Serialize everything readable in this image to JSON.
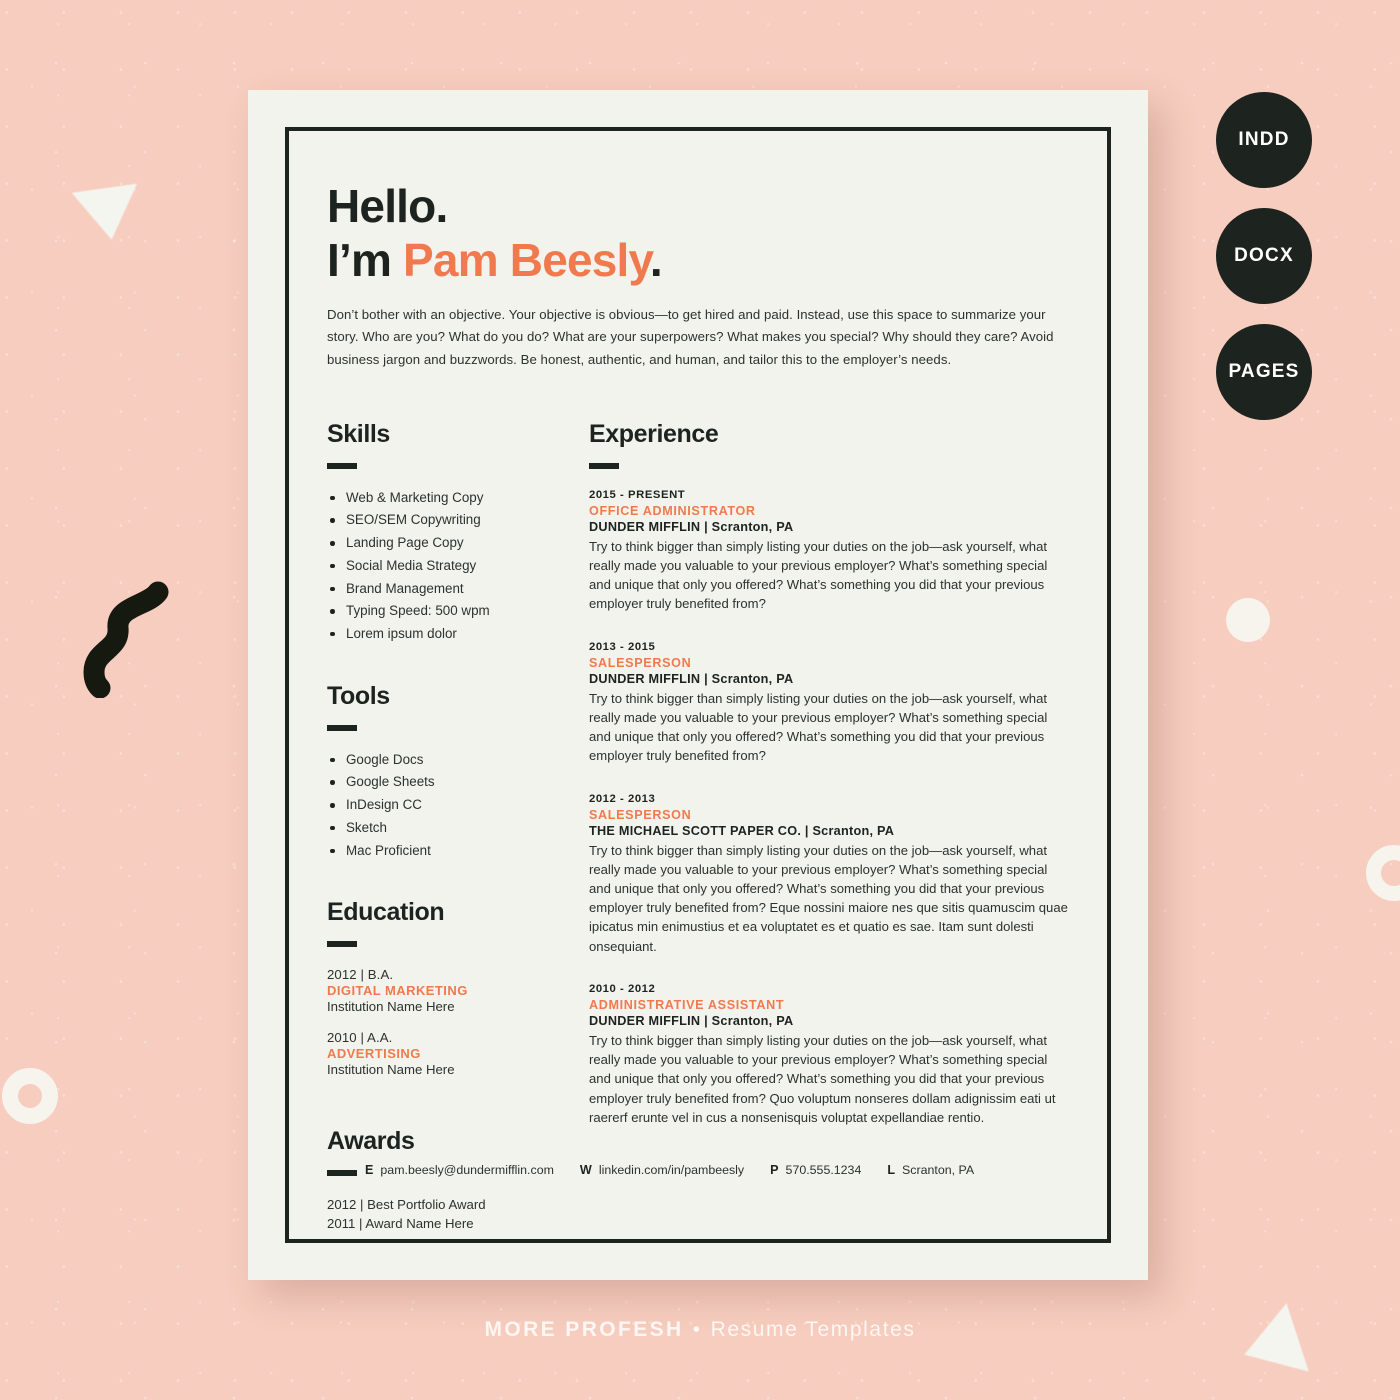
{
  "canvas": {
    "background_color": "#f6cdbe",
    "accent_color": "#f07a4e",
    "ink_color": "#1d231f",
    "paper_color": "#f3f3ee"
  },
  "badges": [
    {
      "label": "INDD"
    },
    {
      "label": "DOCX"
    },
    {
      "label": "PAGES"
    }
  ],
  "resume": {
    "greeting": "Hello.",
    "name_prefix": "I’m ",
    "name": "Pam Beesly",
    "name_suffix": ".",
    "intro": "Don’t bother with an objective. Your objective is obvious—to get hired and paid. Instead, use this space to summarize your story. Who are you? What do you do? What are your superpowers? What makes you special? Why should they care? Avoid business jargon and buzzwords. Be honest, authentic, and human, and tailor this to the employer’s needs.",
    "skills": {
      "heading": "Skills",
      "items": [
        "Web & Marketing Copy",
        "SEO/SEM Copywriting",
        "Landing Page Copy",
        "Social Media Strategy",
        "Brand Management",
        "Typing Speed: 500 wpm",
        "Lorem ipsum dolor"
      ]
    },
    "tools": {
      "heading": "Tools",
      "items": [
        "Google Docs",
        "Google Sheets",
        "InDesign CC",
        "Sketch",
        "Mac Proficient"
      ]
    },
    "education": {
      "heading": "Education",
      "entries": [
        {
          "meta": "2012  |  B.A.",
          "field": "DIGITAL MARKETING",
          "institution": "Institution Name Here"
        },
        {
          "meta": "2010  |  A.A.",
          "field": "ADVERTISING",
          "institution": "Institution Name Here"
        }
      ]
    },
    "awards": {
      "heading": "Awards",
      "entries": [
        "2012  |  Best Portfolio Award",
        "2011  |  Award Name Here"
      ]
    },
    "experience": {
      "heading": "Experience",
      "jobs": [
        {
          "dates": "2015 - PRESENT",
          "title": "OFFICE ADMINISTRATOR",
          "company": "DUNDER MIFFLIN  |  Scranton, PA",
          "description": "Try to think bigger than simply listing your duties on the job—ask yourself, what really made you valuable to your previous employer? What’s something special and unique that only you offered? What’s something you did that your previous employer truly benefited from?"
        },
        {
          "dates": "2013 - 2015",
          "title": "SALESPERSON",
          "company": "DUNDER MIFFLIN  |  Scranton, PA",
          "description": "Try to think bigger than simply listing your duties on the job—ask yourself, what really made you valuable to your previous employer? What’s something special and unique that only you offered? What’s something you did that your previous employer truly benefited from?"
        },
        {
          "dates": "2012 - 2013",
          "title": "SALESPERSON",
          "company": "THE MICHAEL SCOTT PAPER CO.  |  Scranton, PA",
          "description": "Try to think bigger than simply listing your duties on the job—ask yourself, what really made you valuable to your previous employer? What’s something special and unique that only you offered? What’s something you did that your previous employer truly benefited from? Eque nossini maiore nes que sitis quamuscim quae ipicatus min enimustius et ea voluptatet es et quatio es sae. Itam sunt dolesti onsequiant."
        },
        {
          "dates": "2010 - 2012",
          "title": "ADMINISTRATIVE ASSISTANT",
          "company": "DUNDER MIFFLIN  |  Scranton, PA",
          "description": "Try to think bigger than simply listing your duties on the job—ask yourself, what really made you valuable to your previous employer? What’s something special and unique that only you offered? What’s something you did that your previous employer truly benefited from? Quo voluptum nonseres dollam adignissim eati ut raererf erunte vel in cus a nonsenisquis voluptat expellandiae rentio."
        }
      ]
    },
    "contact": [
      {
        "label": "E",
        "value": "pam.beesly@dundermifflin.com"
      },
      {
        "label": "W",
        "value": "linkedin.com/in/pambeesly"
      },
      {
        "label": "P",
        "value": "570.555.1234"
      },
      {
        "label": "L",
        "value": "Scranton, PA"
      }
    ]
  },
  "watermark": {
    "brand": "MORE PROFESH",
    "separator": "•",
    "tagline": "Resume Templates"
  }
}
